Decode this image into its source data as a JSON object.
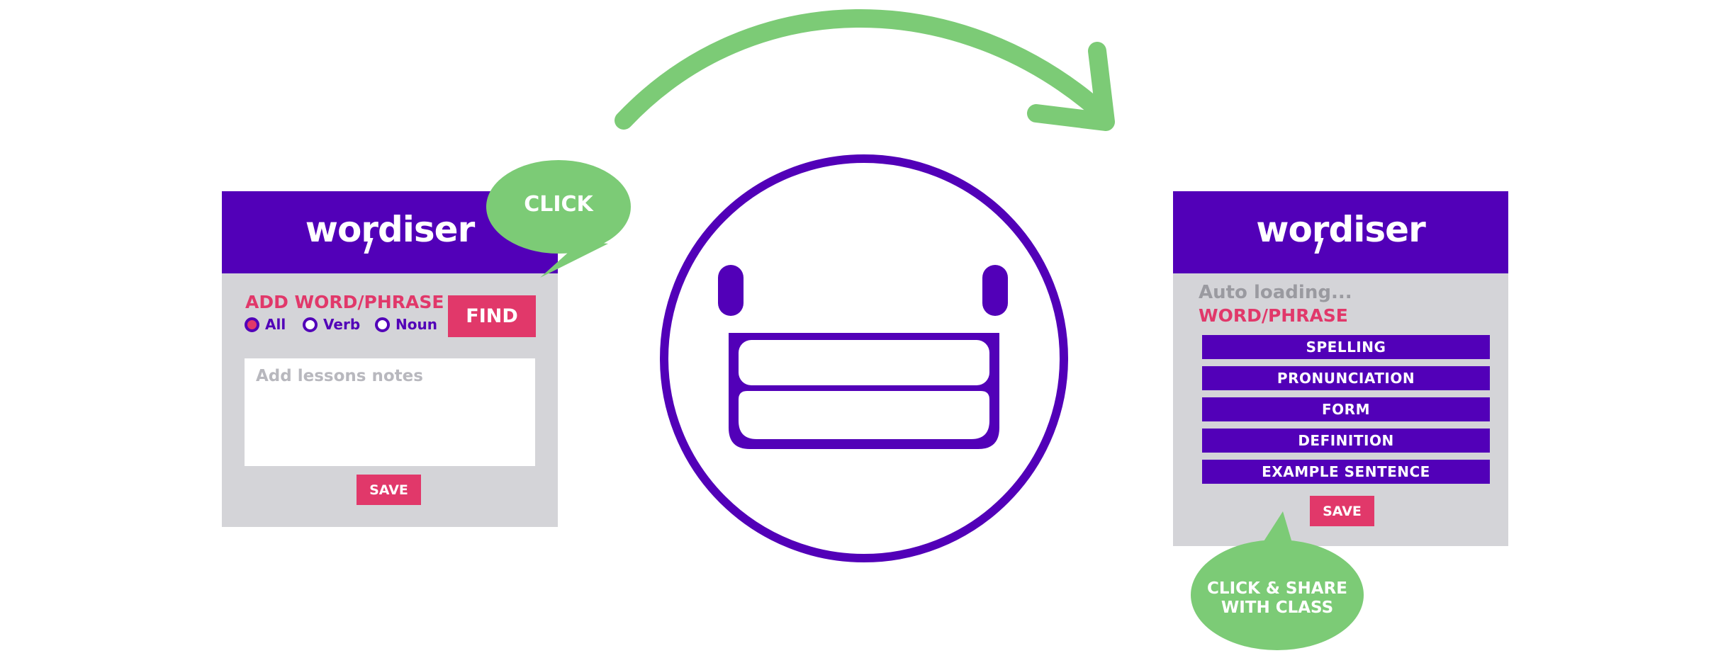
{
  "colors": {
    "brand_purple": "#5200b8",
    "accent_pink": "#e1386a",
    "panel_grey": "#d4d4d8",
    "bubble_green": "#7ccb76"
  },
  "left_panel": {
    "logo": "wordiser",
    "add_label": "ADD WORD/PHRASE",
    "find_label": "FIND",
    "radios": [
      {
        "label": "All",
        "checked": true
      },
      {
        "label": "Verb",
        "checked": false
      },
      {
        "label": "Noun",
        "checked": false
      }
    ],
    "notes_placeholder": "Add lessons notes",
    "save_label": "SAVE"
  },
  "right_panel": {
    "logo": "wordiser",
    "loading_text": "Auto loading...",
    "word_label": "WORD/PHRASE",
    "fields": [
      {
        "label": "SPELLING"
      },
      {
        "label": "PRONUNCIATION"
      },
      {
        "label": "FORM"
      },
      {
        "label": "DEFINITION"
      },
      {
        "label": "EXAMPLE SENTENCE"
      }
    ],
    "save_label": "SAVE"
  },
  "callouts": {
    "click": "CLICK",
    "share_line1": "CLICK & SHARE",
    "share_line2": "WITH CLASS"
  },
  "icons": [
    "smiley-face-icon",
    "curved-arrow-icon",
    "speech-bubble-icon"
  ]
}
